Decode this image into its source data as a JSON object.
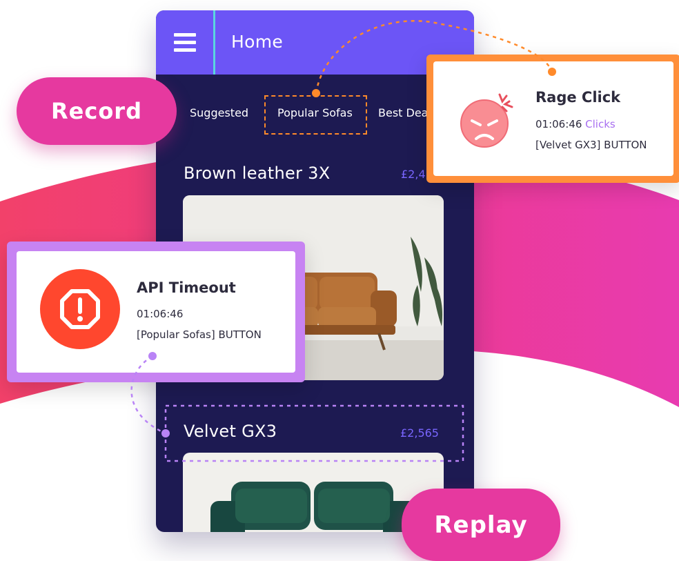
{
  "app": {
    "title": "Home",
    "tabs": [
      "Suggested",
      "Popular Sofas",
      "Best Dea"
    ]
  },
  "products": [
    {
      "name": "Brown leather 3X",
      "price": "£2,4"
    },
    {
      "name": "Velvet GX3",
      "price": "£2,565"
    }
  ],
  "labels": {
    "record": "Record",
    "replay": "Replay"
  },
  "rage_card": {
    "title": "Rage Click",
    "time": "01:06:46",
    "event": "Clicks",
    "target": "[Velvet GX3] BUTTON",
    "icon": "angry-face-icon"
  },
  "api_card": {
    "title": "API Timeout",
    "time": "01:06:46",
    "target": "[Popular Sofas] BUTTON",
    "icon": "alert-octagon-icon"
  },
  "colors": {
    "brand_purple": "#6c55f6",
    "phone_bg": "#1d1a52",
    "pink": "#e6399f",
    "orange": "#ff8f3a",
    "lavender": "#c783f2",
    "alert_red": "#ff4a2e"
  }
}
